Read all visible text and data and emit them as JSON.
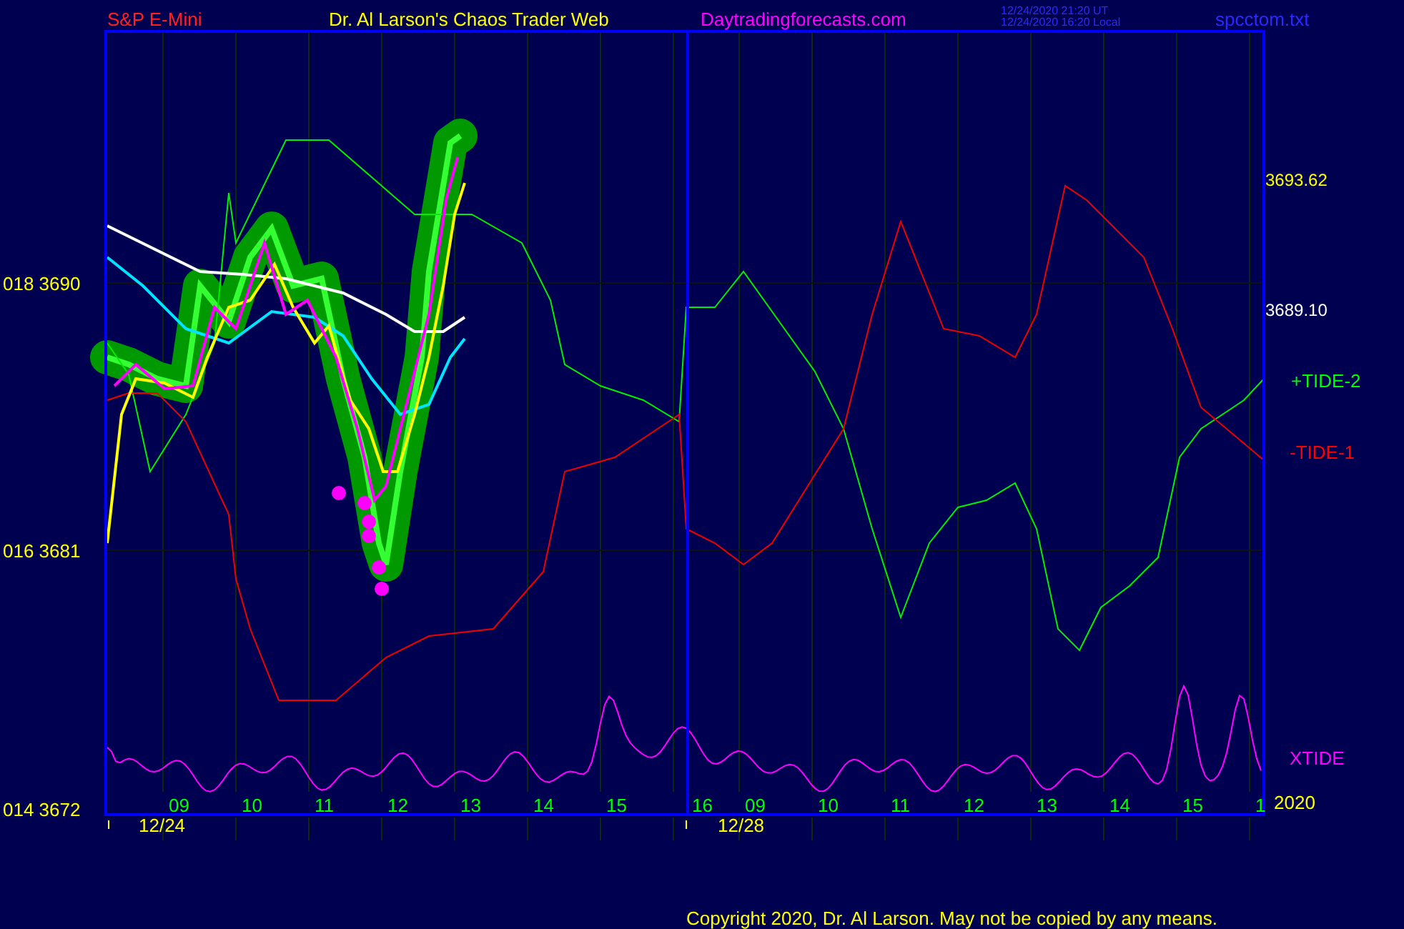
{
  "header": {
    "instrument": "S&P E-Mini",
    "title": "Dr. Al Larson's Chaos Trader Web",
    "site": "Daytradingforecasts.com",
    "time_utc": "12/24/2020 21:20 UT",
    "time_local": "12/24/2020 16:20 Local",
    "file": "spcctom.txt"
  },
  "chart": {
    "y_labels": [
      "018 3690",
      "016 3681",
      "014 3672"
    ],
    "upper_price": "3693.62",
    "last_price": "3689.10",
    "legend": [
      {
        "label": "+TIDE-2",
        "color": "#00ff00"
      },
      {
        "label": "-TIDE-1",
        "color": "#ff0000"
      },
      {
        "label": "XTIDE",
        "color": "#ff00ff"
      }
    ],
    "hour_labels": [
      "09",
      "10",
      "11",
      "12",
      "13",
      "14",
      "15",
      "16",
      "09",
      "10",
      "11",
      "12",
      "13",
      "14",
      "15",
      "1"
    ],
    "date_labels": [
      "12/24",
      "12/28"
    ],
    "year": "2020"
  },
  "footer": "Copyright 2020, Dr. Al Larson. May not be copied by any means."
}
